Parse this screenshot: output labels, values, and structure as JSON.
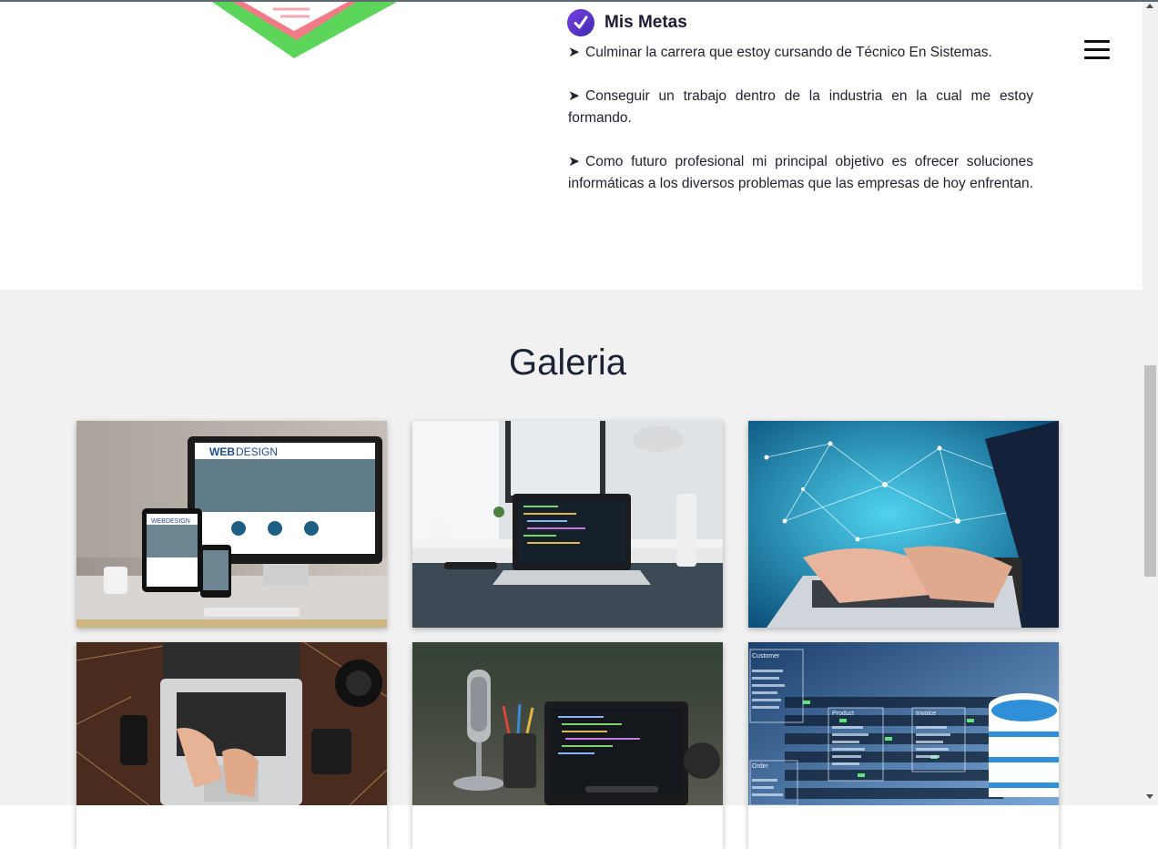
{
  "goals": {
    "title": "Mis Metas",
    "items": [
      "Culminar la carrera que estoy cursando de Técnico En Sistemas.",
      "Conseguir un trabajo dentro de la industria en la cual me estoy formando.",
      "Como futuro profesional mi principal objetivo es ofrecer soluciones informáticas a los diversos problemas que las empresas de hoy enfrentan."
    ],
    "bullet": "➤",
    "icon": "checkmark-icon",
    "accent": "#5b34d6"
  },
  "header": {
    "menu_icon": "hamburger-menu-icon"
  },
  "gallery": {
    "title": "Galeria",
    "background": "#f1f1f1",
    "images": [
      {
        "subject": "web-design-devices-image",
        "overlay": {
          "brand_a": "WEB",
          "brand_b": "DESIGN",
          "brand_small": "WEBDESIGN"
        }
      },
      {
        "subject": "laptop-on-desk-image"
      },
      {
        "subject": "network-typing-image"
      },
      {
        "subject": "laptop-wood-desk-image"
      },
      {
        "subject": "microphone-laptop-image"
      },
      {
        "subject": "database-server-image",
        "overlay": {
          "entity_1": "Customer",
          "entity_2": "Product",
          "entity_3": "Invoice",
          "entity_4": "Order"
        }
      }
    ]
  }
}
